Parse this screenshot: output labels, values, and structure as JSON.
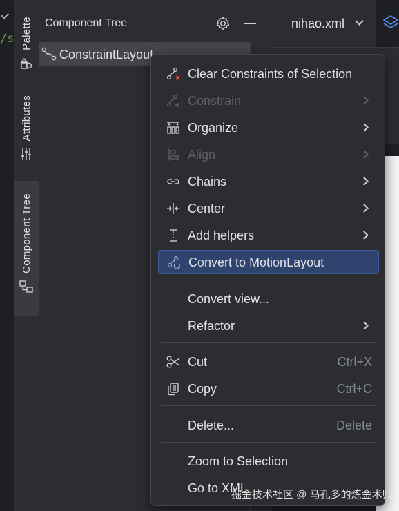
{
  "editor": {
    "code_snippet": "/s"
  },
  "side_tabs": [
    {
      "label": "Palette",
      "icon": "palette-icon"
    },
    {
      "label": "Attributes",
      "icon": "sliders-icon"
    },
    {
      "label": "Component Tree",
      "icon": "component-tree-icon"
    }
  ],
  "component_tree": {
    "title": "Component Tree",
    "root_label": "ConstraintLayout"
  },
  "file_tab": {
    "label": "nihao.xml"
  },
  "context_menu": {
    "items": [
      {
        "label": "Clear Constraints of Selection",
        "icon": "clear-constraints-icon",
        "disabled": false,
        "submenu": false
      },
      {
        "label": "Constrain",
        "icon": "constrain-icon",
        "disabled": true,
        "submenu": true
      },
      {
        "label": "Organize",
        "icon": "organize-icon",
        "disabled": false,
        "submenu": true
      },
      {
        "label": "Align",
        "icon": "align-icon",
        "disabled": true,
        "submenu": true
      },
      {
        "label": "Chains",
        "icon": "chains-icon",
        "disabled": false,
        "submenu": true
      },
      {
        "label": "Center",
        "icon": "center-icon",
        "disabled": false,
        "submenu": true
      },
      {
        "label": "Add helpers",
        "icon": "helpers-icon",
        "disabled": false,
        "submenu": true
      },
      {
        "label": "Convert to MotionLayout",
        "icon": "motionlayout-icon",
        "disabled": false,
        "submenu": false,
        "selected": true
      },
      {
        "label": "Convert view...",
        "disabled": false,
        "submenu": false
      },
      {
        "label": "Refactor",
        "disabled": false,
        "submenu": true
      },
      {
        "label": "Cut",
        "icon": "scissors-icon",
        "shortcut": "Ctrl+X",
        "disabled": false
      },
      {
        "label": "Copy",
        "icon": "copy-icon",
        "shortcut": "Ctrl+C",
        "disabled": false
      },
      {
        "label": "Delete...",
        "shortcut": "Delete",
        "disabled": false
      },
      {
        "label": "Zoom to Selection",
        "disabled": false
      },
      {
        "label": "Go to XML",
        "disabled": false
      }
    ]
  },
  "watermark": "掘金技术社区 @ 马孔多的炼金术师",
  "colors": {
    "selection": "#2e436e",
    "panel": "#2b2d30",
    "background": "#1e1f22"
  }
}
